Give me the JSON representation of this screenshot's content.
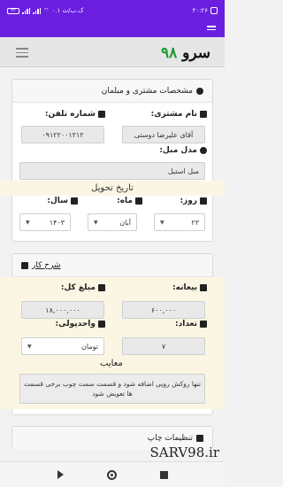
{
  "status": {
    "time": "۲۰:۲۶",
    "speed": "۰.۱ ک.ب/ث",
    "battery": "۴۲"
  },
  "brand": {
    "name": "سرو",
    "number": "۹۸"
  },
  "customer_card": {
    "title": "مشخصات مشتری و مبلمان",
    "name_label": "نام مشتری:",
    "name_value": "آقای علیرضا دوستی",
    "phone_label": "شماره تلفن:",
    "phone_value": "۰۹۱۲۲۰۰۱۲۱۲",
    "model_label": "مدل مبل:",
    "model_value": "مبل استیل",
    "delivery_label": "تاریخ تحویل",
    "day_label": "روز:",
    "day_value": "۲۳",
    "month_label": "ماه:",
    "month_value": "آبان",
    "year_label": "سال:",
    "year_value": "۱۴۰۳"
  },
  "work_card": {
    "title": "شرح کار",
    "deposit_label": "بیعانه:",
    "deposit_value": "۶۰۰,۰۰۰",
    "total_label": "مبلغ کل:",
    "total_value": "۱۸,۰۰۰,۰۰۰",
    "count_label": "تعداد:",
    "count_value": "۷",
    "currency_label": "واحدپولی:",
    "currency_value": "تومان",
    "defects_label": "معایب",
    "defects_value": "تنها روکش رویی اضافه شود و قسمت سمت چوب برخی قسمت ها تعویض شود"
  },
  "print_card": {
    "title": "تنظیمات چاپ"
  },
  "watermark": "SARV98.ir"
}
